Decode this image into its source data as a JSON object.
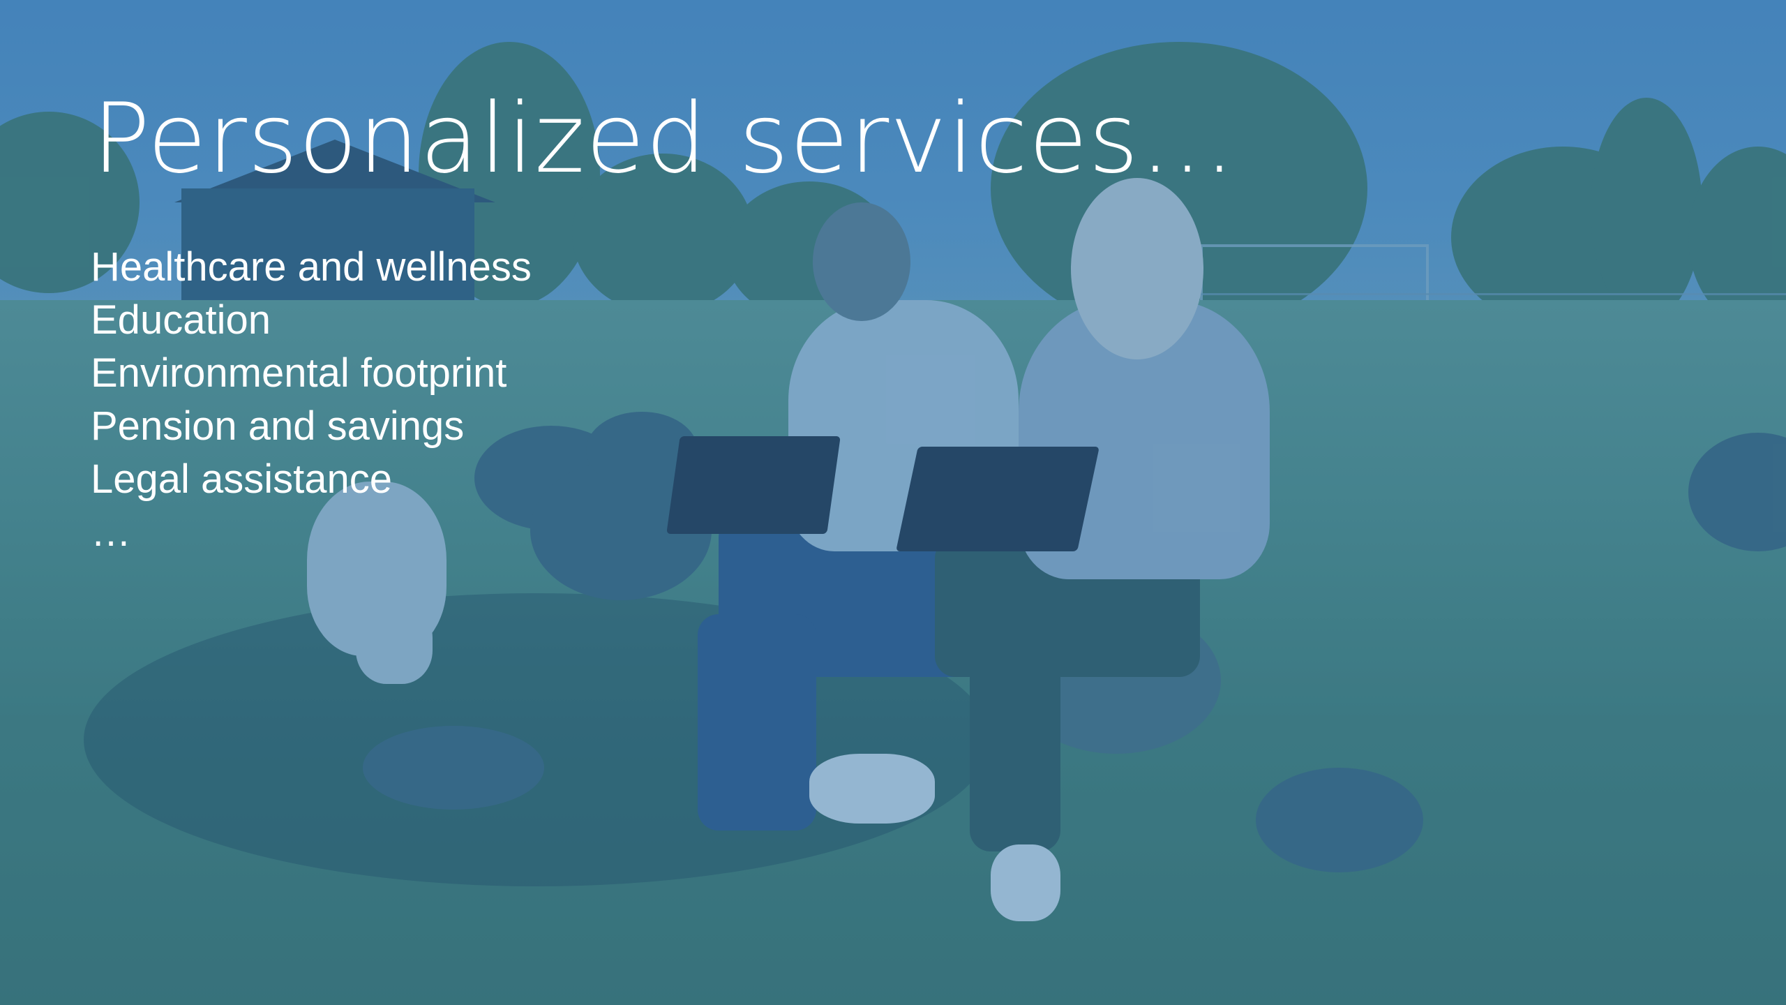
{
  "slide": {
    "title": "Personalized services…",
    "items": [
      "Healthcare and wellness",
      "Education",
      "Environmental footprint",
      "Pension and savings",
      "Legal assistance",
      "…"
    ]
  },
  "background": {
    "image": "two-people-with-laptops-sitting-on-rocks-in-field-with-dog",
    "overlay_color": "#3f7fa8"
  }
}
